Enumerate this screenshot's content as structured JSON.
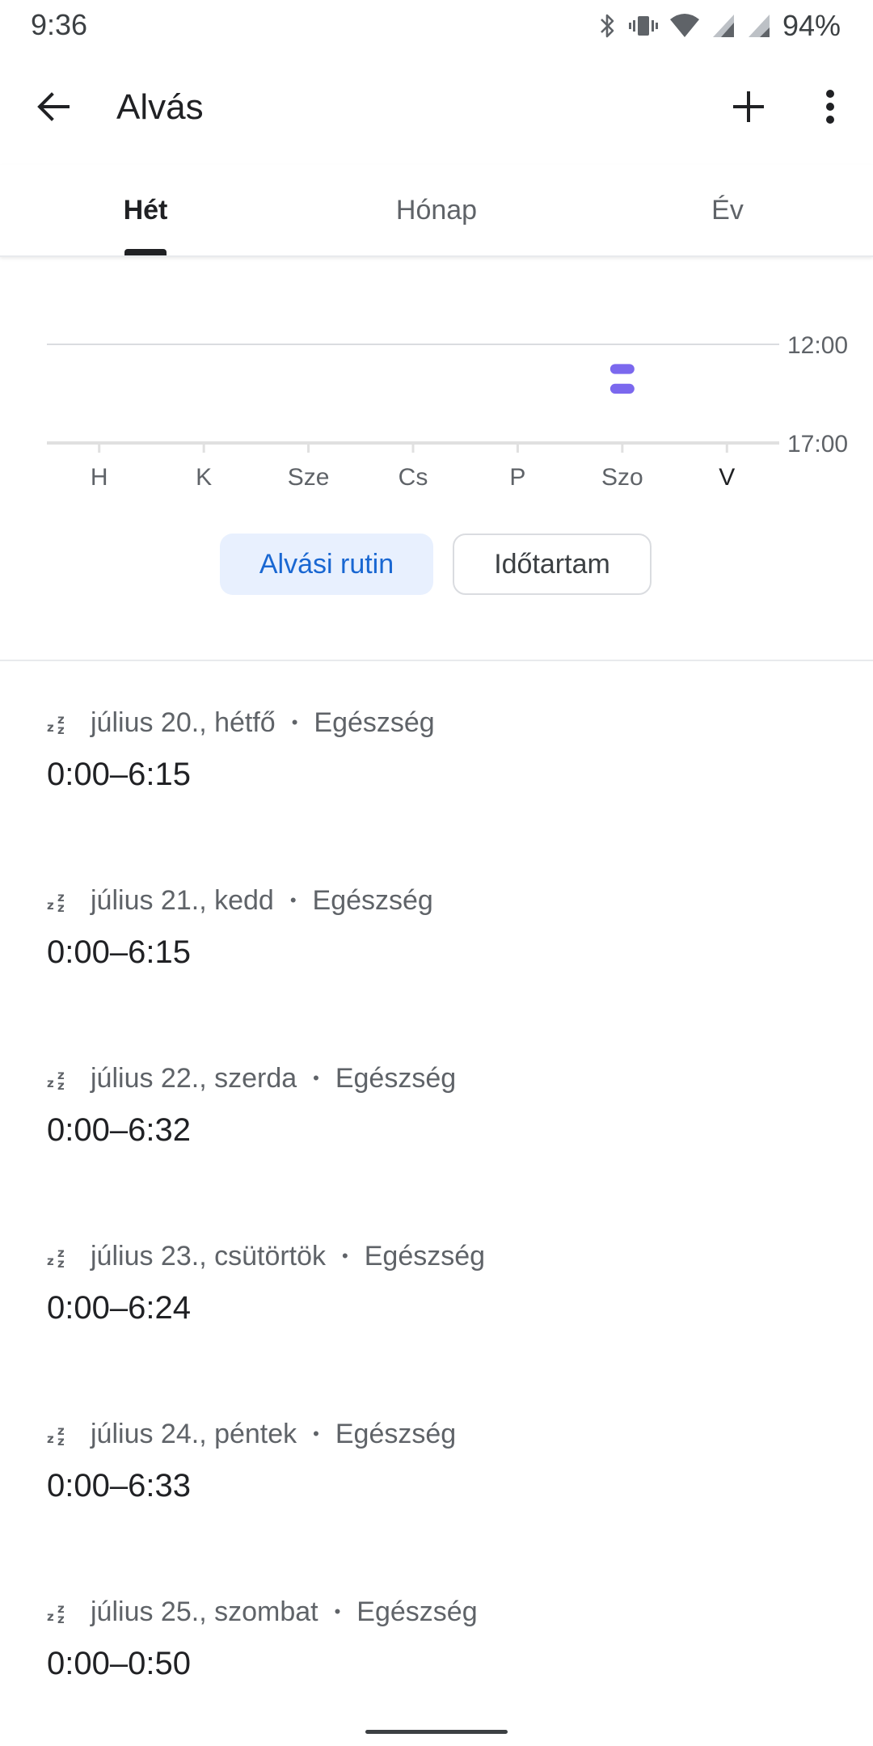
{
  "status_bar": {
    "time": "9:36",
    "battery": "94%",
    "icons": [
      "bluetooth-icon",
      "vibrate-icon",
      "wifi-icon",
      "cell-signal-icon",
      "cell-signal-icon"
    ]
  },
  "app_bar": {
    "title": "Alvás",
    "back_icon": "arrow-back-icon",
    "add_icon": "plus-icon",
    "more_icon": "more-vert-icon"
  },
  "tabs": [
    {
      "label": "Hét",
      "active": true
    },
    {
      "label": "Hónap",
      "active": false
    },
    {
      "label": "Év",
      "active": false
    }
  ],
  "chart_data": {
    "type": "bar",
    "categories": [
      "H",
      "K",
      "Sze",
      "Cs",
      "P",
      "Szo",
      "V"
    ],
    "highlighted_category": "V",
    "y_tick_labels": [
      "12:00",
      "17:00"
    ],
    "series": [
      {
        "values": [
          null,
          null,
          null,
          null,
          null,
          null,
          null
        ],
        "markers": [
          {
            "category": "Szo",
            "start": "13:00",
            "end": "13:30"
          },
          {
            "category": "Szo",
            "start": "14:00",
            "end": "14:30"
          }
        ]
      }
    ],
    "colors": {
      "marker": "#7b68ee",
      "grid": "#dadce0",
      "axis": "#e0e0e0"
    }
  },
  "filters": {
    "selected": "Alvási rutin",
    "other": "Időtartam"
  },
  "sleep_entries": [
    {
      "date": "július 20., hétfő",
      "source": "Egészség",
      "range": "0:00–6:15"
    },
    {
      "date": "július 21., kedd",
      "source": "Egészség",
      "range": "0:00–6:15"
    },
    {
      "date": "július 22., szerda",
      "source": "Egészség",
      "range": "0:00–6:32"
    },
    {
      "date": "július 23., csütörtök",
      "source": "Egészség",
      "range": "0:00–6:24"
    },
    {
      "date": "július 24., péntek",
      "source": "Egészség",
      "range": "0:00–6:33"
    },
    {
      "date": "július 25., szombat",
      "source": "Egészség",
      "range": "0:00–0:50"
    }
  ],
  "colors": {
    "accent": "#1967d2",
    "chip_selected_bg": "#e8f0fe",
    "text_primary": "#202124",
    "text_secondary": "#5f6368"
  }
}
